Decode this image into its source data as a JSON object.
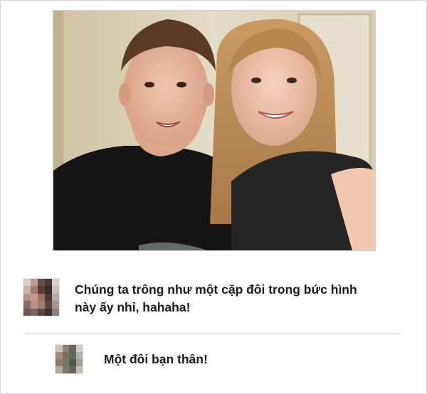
{
  "photo": {
    "description_icon": "selfie-photo"
  },
  "comments": [
    {
      "avatar_icon": "blurred-avatar",
      "text": "Chúng ta trông như một cặp đôi trong bức hình này ấy nhỉ, hahaha!"
    },
    {
      "avatar_icon": "blurred-avatar",
      "text": "Một đôi bạn thân!"
    }
  ],
  "colors": {
    "text": "#1a1a1a",
    "divider": "#c9c9c9",
    "background": "#ffffff"
  }
}
